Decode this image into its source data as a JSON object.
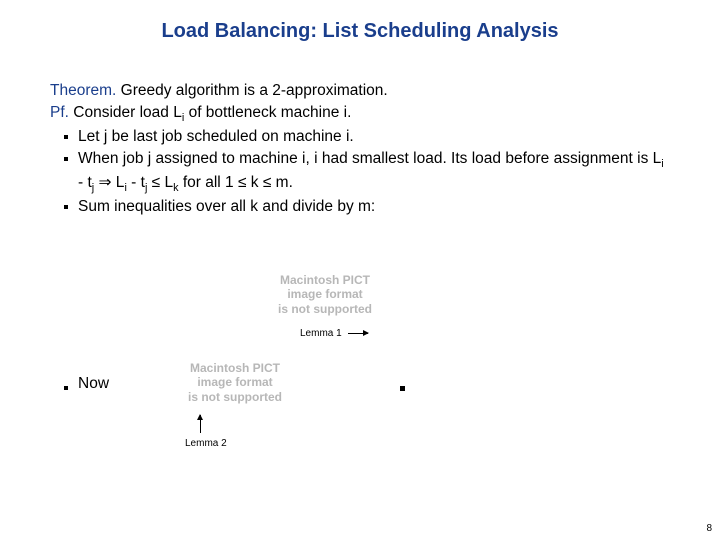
{
  "title": "Load Balancing:  List Scheduling Analysis",
  "theorem_label": "Theorem.",
  "theorem_text": "Greedy algorithm is a 2-approximation.",
  "pf_label": "Pf.",
  "pf_text_pre": "Consider load L",
  "pf_text_sub": "i",
  "pf_text_post": " of bottleneck machine i.",
  "bullets": {
    "b1": "Let j be last job scheduled on machine i.",
    "b2_pre": "When job j assigned to machine i, i had smallest load.  Its load before assignment is L",
    "b2_sub1": "i",
    "b2_mid1": " - t",
    "b2_sub2": "j",
    "b2_imp": "  ⇒  L",
    "b2_sub3": "i",
    "b2_mid2": " - t",
    "b2_sub4": "j",
    "b2_le1": "  ≤ L",
    "b2_sub5": "k",
    "b2_forall": "  for all 1 ≤ k ≤ m.",
    "b3": "Sum inequalities over all k and divide by m:"
  },
  "pict": {
    "l1": "Macintosh PICT",
    "l2": "image format",
    "l3": "is not supported"
  },
  "lemma1": "Lemma 1",
  "now": "Now",
  "lemma2": "Lemma 2",
  "page": "8"
}
